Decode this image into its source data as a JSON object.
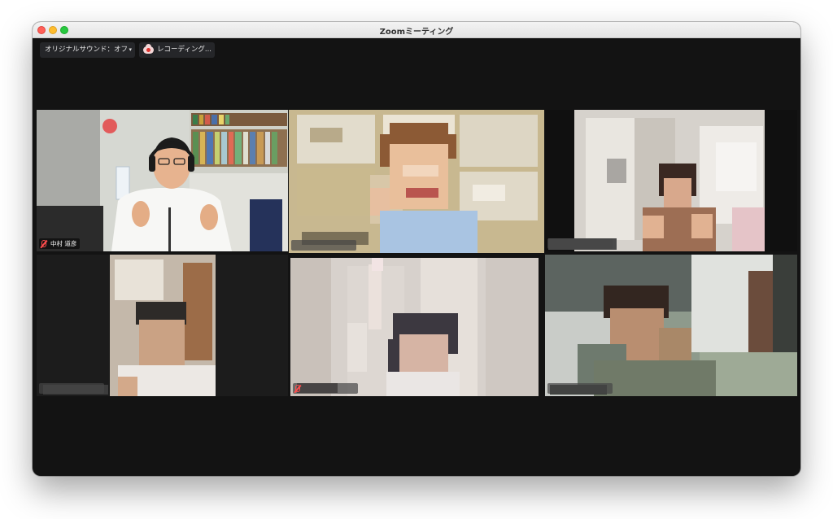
{
  "window": {
    "title": "Zoomミーティング"
  },
  "toolbar": {
    "audio_label": "オリジナルサウンド：オフ",
    "audio_caret": "▾",
    "recording_label": "レコーディング..."
  },
  "participants": [
    {
      "name": "中村 道彦",
      "muted": true,
      "pixelated": false,
      "active_speaker": false
    },
    {
      "name": "",
      "muted": false,
      "pixelated": true,
      "active_speaker": true
    },
    {
      "name": "",
      "muted": false,
      "pixelated": true,
      "active_speaker": false
    },
    {
      "name": "",
      "muted": false,
      "pixelated": true,
      "active_speaker": false
    },
    {
      "name": "",
      "muted": true,
      "pixelated": true,
      "active_speaker": false
    },
    {
      "name": "",
      "muted": false,
      "pixelated": true,
      "active_speaker": false
    }
  ],
  "colors": {
    "meeting_background": "#131313",
    "active_speaker_border": "#d8e59a",
    "muted_red": "#ff4d4d",
    "recording_red": "#e0332f"
  },
  "icons": {
    "close": "close-icon",
    "minimize": "minimize-icon",
    "maximize": "maximize-icon",
    "recording": "cloud-recording-icon",
    "muted_mic": "mic-muted-icon"
  }
}
